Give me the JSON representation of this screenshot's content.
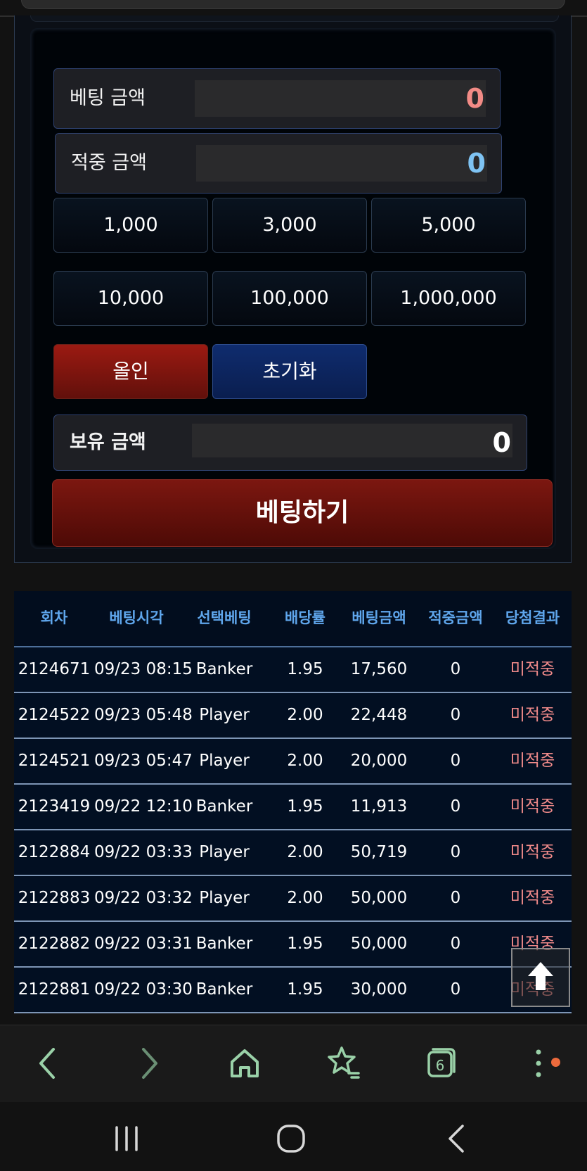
{
  "betting": {
    "bet_amount": {
      "label": "베팅 금액",
      "value": "0"
    },
    "win_amount": {
      "label": "적중 금액",
      "value": "0"
    },
    "chips": [
      "1,000",
      "3,000",
      "5,000",
      "10,000",
      "100,000",
      "1,000,000"
    ],
    "all_in_label": "올인",
    "reset_label": "초기화",
    "balance": {
      "label": "보유 금액",
      "value": "0"
    },
    "bet_button_label": "베팅하기"
  },
  "history": {
    "columns": [
      "회차",
      "베팅시각",
      "선택베팅",
      "배당률",
      "베팅금액",
      "적중금액",
      "당첨결과"
    ],
    "rows": [
      [
        "2124671",
        "09/23 08:15",
        "Banker",
        "1.95",
        "17,560",
        "0",
        "미적중"
      ],
      [
        "2124522",
        "09/23 05:48",
        "Player",
        "2.00",
        "22,448",
        "0",
        "미적중"
      ],
      [
        "2124521",
        "09/23 05:47",
        "Player",
        "2.00",
        "20,000",
        "0",
        "미적중"
      ],
      [
        "2123419",
        "09/22 12:10",
        "Banker",
        "1.95",
        "11,913",
        "0",
        "미적중"
      ],
      [
        "2122884",
        "09/22 03:33",
        "Player",
        "2.00",
        "50,719",
        "0",
        "미적중"
      ],
      [
        "2122883",
        "09/22 03:32",
        "Player",
        "2.00",
        "50,000",
        "0",
        "미적중"
      ],
      [
        "2122882",
        "09/22 03:31",
        "Banker",
        "1.95",
        "50,000",
        "0",
        "미적중"
      ],
      [
        "2122881",
        "09/22 03:30",
        "Banker",
        "1.95",
        "30,000",
        "0",
        "미적중"
      ]
    ]
  },
  "browser_nav": {
    "icons": [
      "back-icon",
      "forward-icon",
      "home-icon",
      "bookmarks-icon",
      "tabs-icon",
      "menu-icon"
    ],
    "tab_count": "6"
  },
  "system_nav": {
    "icons": [
      "recents-icon",
      "home-circle-icon",
      "system-back-icon"
    ]
  },
  "colors": {
    "bet_value": "#f28b86",
    "win_value": "#7ec3f3",
    "header_text": "#5fa6ec",
    "miss_text": "#f08a8a",
    "all_in": "#8a1a12",
    "reset": "#0f2a68",
    "browser_icons": "#9ad1a8"
  }
}
